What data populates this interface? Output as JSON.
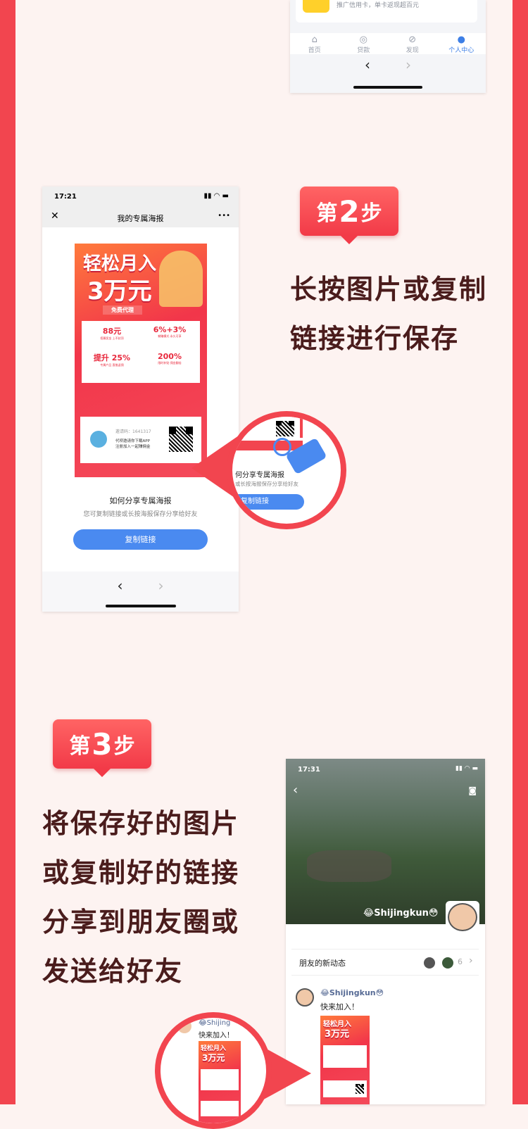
{
  "colors": {
    "brand_red": "#f2454f",
    "bg": "#fdf3f1",
    "blue": "#4a8af0",
    "heading": "#4a1c1c"
  },
  "step1_phone": {
    "card_text": "推广信用卡，单卡返现超百元",
    "tabs": [
      {
        "label": "首页",
        "icon": "home-icon"
      },
      {
        "label": "贷款",
        "icon": "loan-icon"
      },
      {
        "label": "发现",
        "icon": "compass-icon"
      },
      {
        "label": "个人中心",
        "icon": "user-icon",
        "active": true
      }
    ],
    "back": "‹",
    "forward": "›"
  },
  "step2": {
    "badge_prefix": "第",
    "badge_num": "2",
    "badge_suffix": "步",
    "lines": [
      "长按图片或复制",
      "链接进行保存"
    ]
  },
  "step2_phone": {
    "time": "17:21",
    "title": "我的专属海报",
    "close": "✕",
    "more": "•••",
    "poster": {
      "headline1": "轻松月入",
      "headline2": "3万元",
      "tag": "免费代理",
      "stats": [
        {
          "value": "88元",
          "desc": "招募奖金 上不封顶"
        },
        {
          "value": "6%+3%",
          "desc": "躺赚模式 永久可享"
        },
        {
          "value": "提升 25%",
          "desc": "专属产品 直推返佣"
        },
        {
          "value": "200%",
          "desc": "限时补贴 佣金翻倍"
        }
      ],
      "invite_label": "邀请码：1641317",
      "invite_line1": "代呗邀请你下载APP",
      "invite_line2": "注册加入一起赚佣金"
    },
    "share_title": "如何分享专属海报",
    "share_desc": "您可复制链接或长按海报保存分享给好友",
    "copy_button": "复制链接",
    "back": "‹",
    "forward": "›"
  },
  "magnifier1": {
    "title": "何分享专属海报",
    "desc": "或长按海报保存分享给好友",
    "button": "复制链接"
  },
  "step3": {
    "badge_prefix": "第",
    "badge_num": "3",
    "badge_suffix": "步",
    "lines": [
      "将保存好的图片",
      "或复制好的链接",
      "分享到朋友圈或",
      "发送给好友"
    ]
  },
  "step3_phone": {
    "time": "17:31",
    "profile_name": "😂Shijingkun😳",
    "friends_row": "朋友的新动态",
    "friends_count": "6",
    "post_name": "😂Shijingkun😳",
    "post_text": "快来加入！",
    "thumb_h1": "轻松月入",
    "thumb_h2": "3万元"
  },
  "magnifier2": {
    "name": "😂Shijing",
    "text": "快来加入！",
    "h1": "轻松月入",
    "h2": "3万元"
  }
}
